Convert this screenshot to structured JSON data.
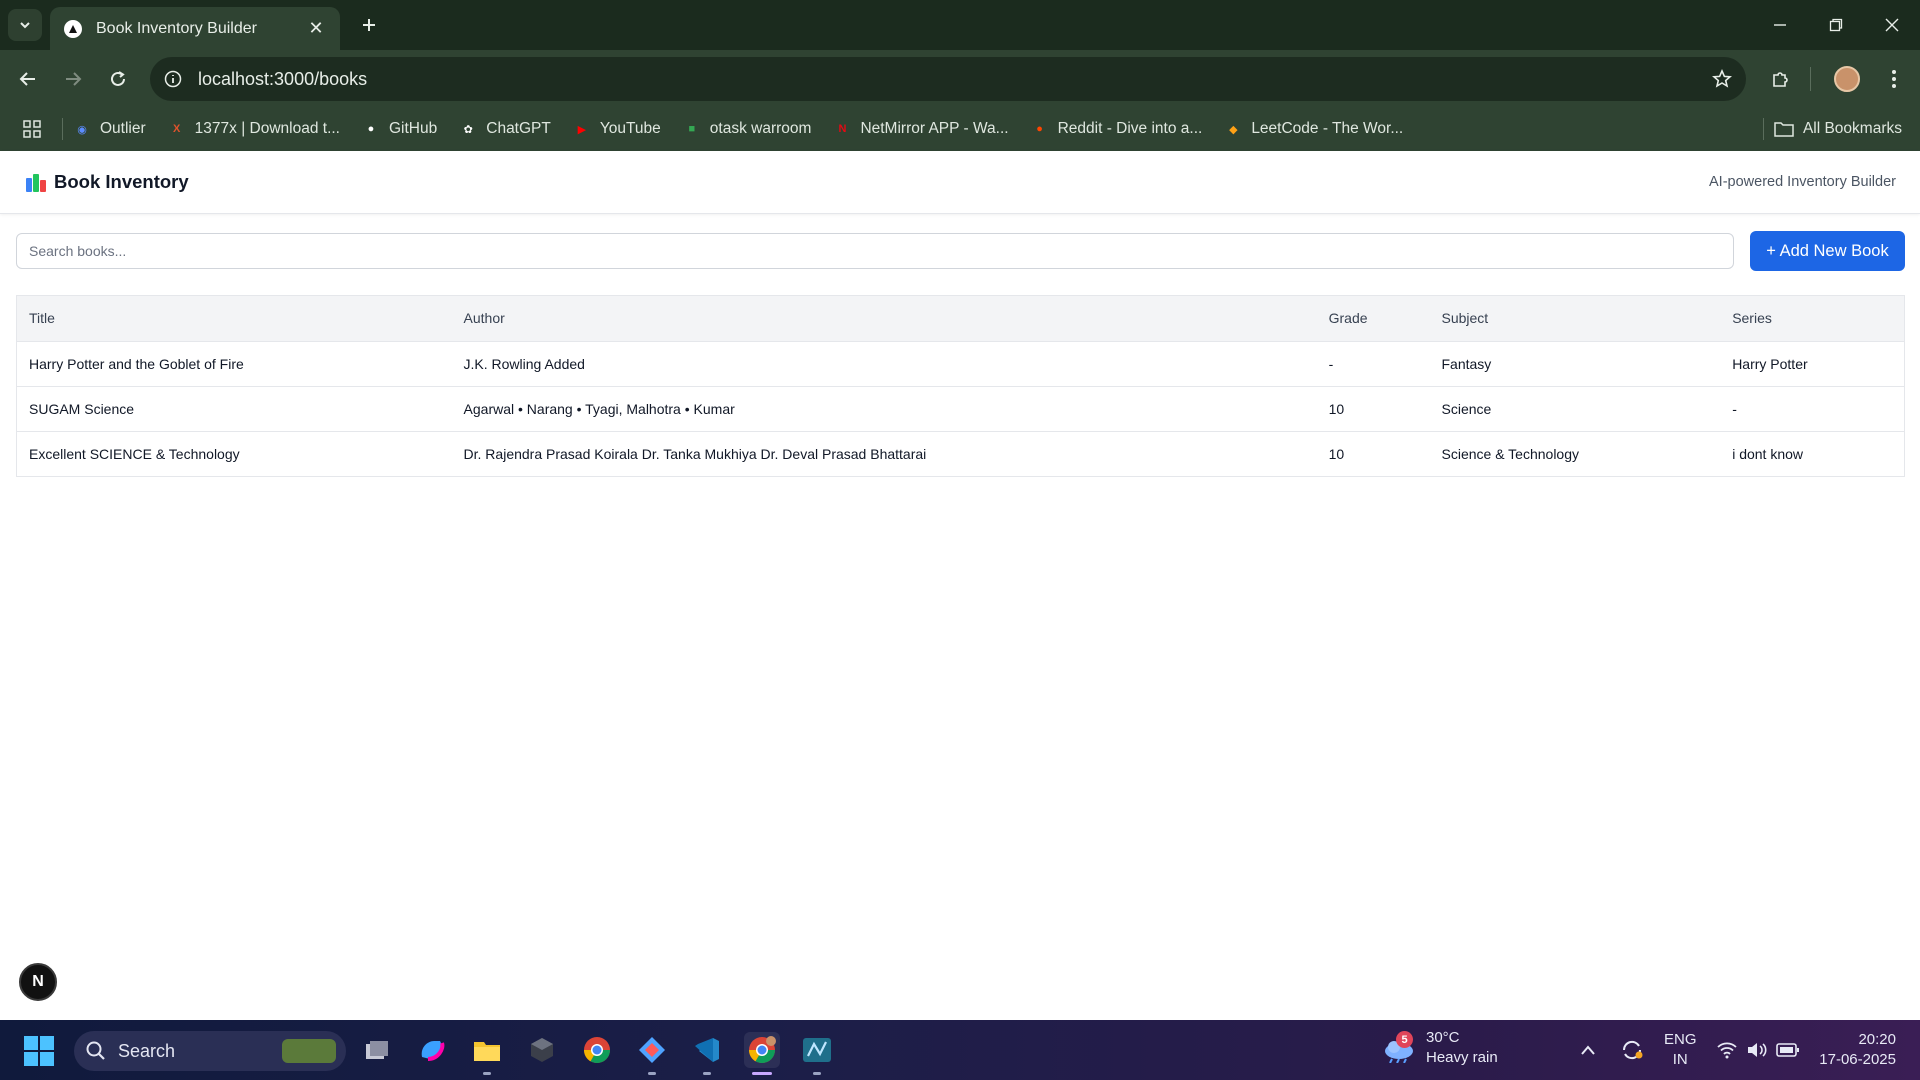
{
  "browser": {
    "tab_title": "Book Inventory Builder",
    "url": "localhost:3000/books",
    "bookmarks": [
      {
        "label": "Outlier",
        "icon": "outlier-icon",
        "color": "#5b8cff"
      },
      {
        "label": "1377x | Download t...",
        "icon": "x-icon",
        "color": "#e0532c"
      },
      {
        "label": "GitHub",
        "icon": "github-icon",
        "color": "#ffffff"
      },
      {
        "label": "ChatGPT",
        "icon": "chatgpt-icon",
        "color": "#ffffff"
      },
      {
        "label": "YouTube",
        "icon": "youtube-icon",
        "color": "#ff0000"
      },
      {
        "label": "otask warroom",
        "icon": "google-icon",
        "color": "#34a853"
      },
      {
        "label": "NetMirror APP - Wa...",
        "icon": "netmirror-icon",
        "color": "#e50914"
      },
      {
        "label": "Reddit - Dive into a...",
        "icon": "reddit-icon",
        "color": "#ff4500"
      },
      {
        "label": "LeetCode - The Wor...",
        "icon": "leetcode-icon",
        "color": "#ffa116"
      }
    ],
    "all_bookmarks": "All Bookmarks"
  },
  "app": {
    "title": "Book Inventory",
    "tagline": "AI-powered Inventory Builder",
    "search_placeholder": "Search books...",
    "add_button": "+ Add New Book",
    "accent": "#1d66e5"
  },
  "table": {
    "headers": [
      "Title",
      "Author",
      "Grade",
      "Subject",
      "Series"
    ],
    "rows": [
      [
        "Harry Potter and the Goblet of Fire",
        "J.K. Rowling Added",
        "-",
        "Fantasy",
        "Harry Potter"
      ],
      [
        "SUGAM Science",
        "Agarwal • Narang • Tyagi, Malhotra • Kumar",
        "10",
        "Science",
        "-"
      ],
      [
        "Excellent SCIENCE & Technology",
        "Dr. Rajendra Prasad Koirala Dr. Tanka Mukhiya Dr. Deval Prasad Bhattarai",
        "10",
        "Science & Technology",
        "i dont know"
      ]
    ]
  },
  "next_badge": "N",
  "taskbar": {
    "search_label": "Search",
    "weather_badge": "5",
    "temperature": "30°C",
    "weather_desc": "Heavy rain",
    "lang_top": "ENG",
    "lang_bottom": "IN",
    "time": "20:20",
    "date": "17-06-2025"
  }
}
